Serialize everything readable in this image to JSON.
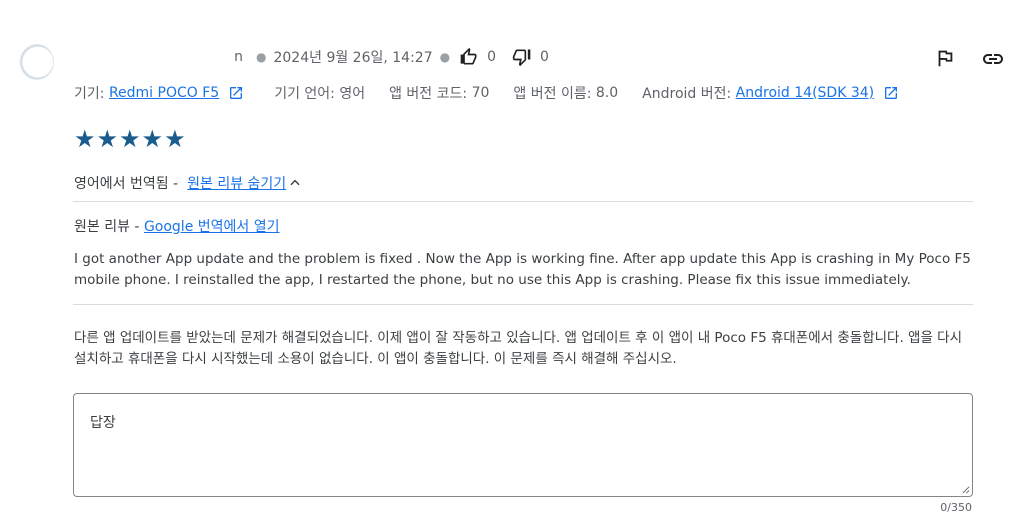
{
  "review": {
    "author": "n",
    "date": "2024년 9월 26일, 14:27",
    "thumbs_up_count": "0",
    "thumbs_down_count": "0",
    "device": {
      "device_label": "기기:",
      "device_name": "Redmi POCO F5",
      "language_label": "기기 언어:",
      "language": "영어",
      "version_code_label": "앱 버전 코드:",
      "version_code": "70",
      "version_name_label": "앱 버전 이름:",
      "version_name": "8.0",
      "android_label": "Android 버전:",
      "android_version": "Android 14(SDK 34)"
    },
    "stars": [
      "★",
      "★",
      "★",
      "★",
      "★"
    ],
    "rating": 5,
    "translated_from": "영어에서 번역됨 -",
    "hide_original_link": "원본 리뷰 숨기기",
    "original_label": "원본 리뷰 -",
    "google_translate_link": "Google 번역에서 열기",
    "original_text": "I got another App update and the problem is fixed . Now the App is working fine. After app update this App is crashing in My Poco F5 mobile phone. I reinstalled the app, I restarted the phone, but no use this App is crashing. Please fix this issue immediately.",
    "translated_text": "다른 앱 업데이트를 받았는데 문제가 해결되었습니다. 이제 앱이 잘 작동하고 있습니다. 앱 업데이트 후 이 앱이 내 Poco F5 휴대폰에서 충돌합니다. 앱을 다시 설치하고 휴대폰을 다시 시작했는데 소용이 없습니다. 이 앱이 충돌합니다. 이 문제를 즉시 해결해 주십시오."
  },
  "reply": {
    "placeholder": "답장",
    "counter": "0/350"
  },
  "icons": {
    "thumbs_up": "thumb-up-icon",
    "thumbs_down": "thumb-down-icon",
    "flag": "flag-icon",
    "link": "link-icon",
    "external": "open-in-new-icon"
  },
  "colors": {
    "link": "#1a73e8",
    "star": "#1a5c8c",
    "text": "#3c4043",
    "muted": "#5f6368"
  }
}
